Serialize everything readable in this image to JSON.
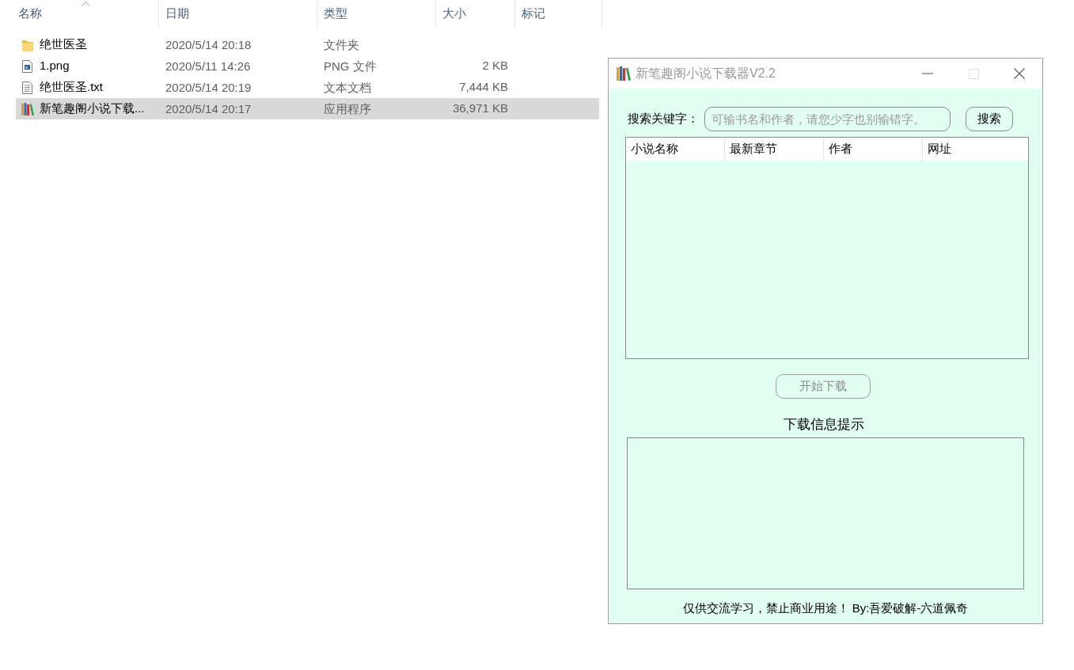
{
  "file_list": {
    "columns": [
      {
        "label": "名称",
        "sorted": true
      },
      {
        "label": "日期",
        "sorted": false
      },
      {
        "label": "类型",
        "sorted": false
      },
      {
        "label": "大小",
        "sorted": false
      },
      {
        "label": "标记",
        "sorted": false
      }
    ],
    "rows": [
      {
        "kind": "folder",
        "name": "绝世医圣",
        "date": "2020/5/14 20:18",
        "type": "文件夹",
        "selected": false
      },
      {
        "kind": "image",
        "name": "1.png",
        "date": "2020/5/11 14:26",
        "type": "PNG 文件",
        "size": "2 KB",
        "selected": false
      },
      {
        "kind": "text",
        "name": "绝世医圣.txt",
        "date": "2020/5/14 20:19",
        "type": "文本文档",
        "size": "7,444 KB",
        "selected": false
      },
      {
        "kind": "app",
        "name": "新笔趣阁小说下载...",
        "date": "2020/5/14 20:17",
        "type": "应用程序",
        "size": "36,971 KB",
        "selected": true
      }
    ]
  },
  "app_window": {
    "title": "新笔趣阁小说下载器V2.2",
    "window_buttons": [
      {
        "kind": "minimize",
        "disabled": false
      },
      {
        "kind": "maximize",
        "disabled": true
      },
      {
        "kind": "close",
        "disabled": false
      }
    ],
    "search": {
      "label": "搜索关键字：",
      "placeholder": "可输书名和作者，请您少字也别输错字。"
    },
    "search_button": {
      "label": "搜索",
      "disabled": false
    },
    "results_table": {
      "columns": [
        "小说名称",
        "最新章节",
        "作者",
        "网址"
      ]
    },
    "download_button": {
      "label": "开始下载",
      "disabled": true
    },
    "log_label": "下载信息提示",
    "footer": "仅供交流学习，禁止商业用途！ By:吾爱破解-六道佩奇"
  }
}
